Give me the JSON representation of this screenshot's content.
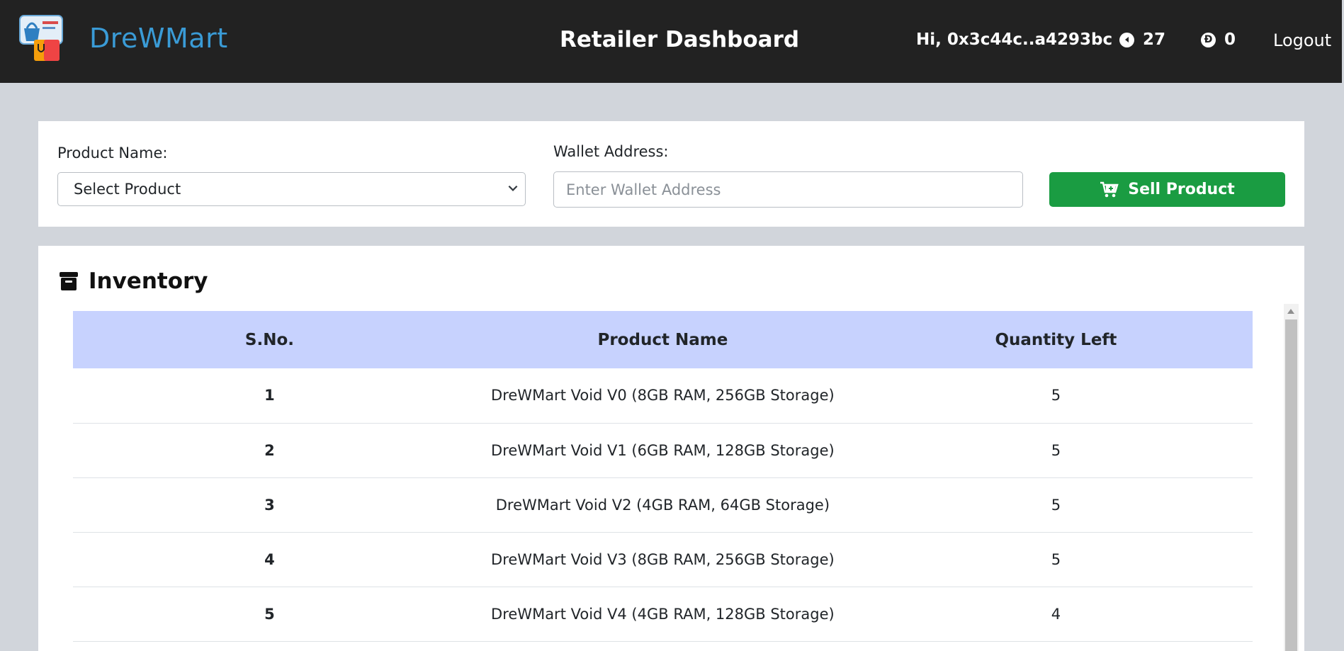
{
  "navbar": {
    "logo_text": "DreWMart",
    "title": "Retailer Dashboard",
    "greeting": "Hi, 0x3c44c..a4293bc",
    "token_count": "27",
    "drew_count": "0",
    "drew_symbol": "Đ",
    "logout_label": "Logout"
  },
  "sell_form": {
    "product_label": "Product Name:",
    "product_selected": "Select Product",
    "wallet_label": "Wallet Address:",
    "wallet_placeholder": "Enter Wallet Address",
    "sell_button_label": "Sell Product"
  },
  "inventory": {
    "title": "Inventory",
    "columns": [
      "S.No.",
      "Product Name",
      "Quantity Left"
    ],
    "rows": [
      {
        "sno": "1",
        "name": "DreWMart Void V0 (8GB RAM, 256GB Storage)",
        "qty": "5"
      },
      {
        "sno": "2",
        "name": "DreWMart Void V1 (6GB RAM, 128GB Storage)",
        "qty": "5"
      },
      {
        "sno": "3",
        "name": "DreWMart Void V2 (4GB RAM, 64GB Storage)",
        "qty": "5"
      },
      {
        "sno": "4",
        "name": "DreWMart Void V3 (8GB RAM, 256GB Storage)",
        "qty": "5"
      },
      {
        "sno": "5",
        "name": "DreWMart Void V4 (4GB RAM, 128GB Storage)",
        "qty": "4"
      }
    ]
  },
  "colors": {
    "navbar_bg": "#222222",
    "page_bg": "#d1d5db",
    "logo_text": "#3a9bd6",
    "sell_button": "#1a9c42",
    "table_header": "#c7d2fe"
  },
  "icons": {
    "logo": "shopping-basket-bag-logo",
    "token": "token-play-icon",
    "drew": "drew-coin-icon",
    "sell": "cart-plus-icon",
    "inventory": "archive-box-icon",
    "select": "chevron-down-icon"
  }
}
